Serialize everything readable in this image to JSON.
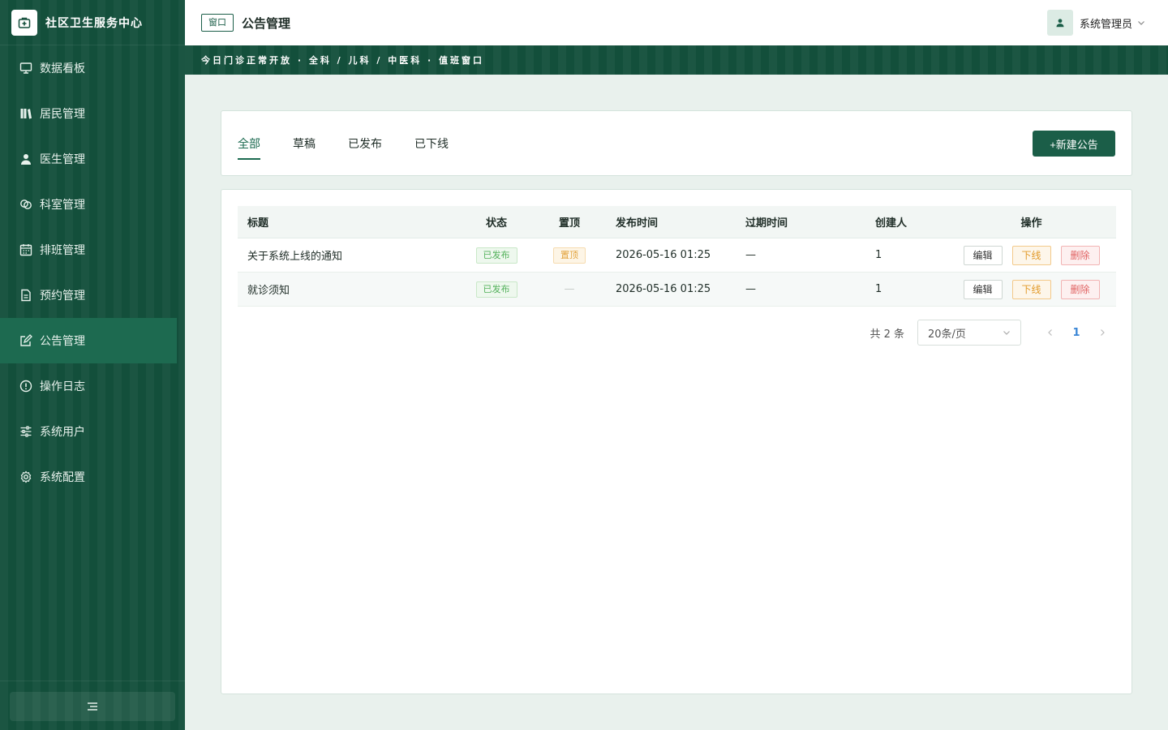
{
  "brand": {
    "title": "社区卫生服务中心"
  },
  "sidebar": {
    "items": [
      {
        "label": "数据看板",
        "icon": "monitor-icon"
      },
      {
        "label": "居民管理",
        "icon": "books-icon"
      },
      {
        "label": "医生管理",
        "icon": "person-icon"
      },
      {
        "label": "科室管理",
        "icon": "link-icon"
      },
      {
        "label": "排班管理",
        "icon": "calendar-icon"
      },
      {
        "label": "预约管理",
        "icon": "document-icon"
      },
      {
        "label": "公告管理",
        "icon": "edit-icon",
        "active": true
      },
      {
        "label": "操作日志",
        "icon": "info-icon"
      },
      {
        "label": "系统用户",
        "icon": "sliders-icon"
      },
      {
        "label": "系统配置",
        "icon": "gear-icon"
      }
    ]
  },
  "header": {
    "window_tag": "窗口",
    "title": "公告管理",
    "user_name": "系统管理员"
  },
  "ticker": {
    "text": "今日门诊正常开放 · 全科 / 儿科 / 中医科 · 值班窗口"
  },
  "tabs": {
    "items": [
      "全部",
      "草稿",
      "已发布",
      "已下线"
    ],
    "active": "全部",
    "new_label": "+新建公告"
  },
  "table": {
    "columns": [
      "标题",
      "状态",
      "置顶",
      "发布时间",
      "过期时间",
      "创建人",
      "操作"
    ],
    "rows": [
      {
        "title": "关于系统上线的通知",
        "status": "已发布",
        "pinned": "置顶",
        "published_at": "2026-05-16 01:25",
        "expires_at": "—",
        "creator": "1"
      },
      {
        "title": "就诊须知",
        "status": "已发布",
        "pinned": "—",
        "published_at": "2026-05-16 01:25",
        "expires_at": "—",
        "creator": "1"
      }
    ],
    "ops": {
      "edit": "编辑",
      "offline": "下线",
      "delete": "删除"
    }
  },
  "pagination": {
    "total_text": "共 2 条",
    "page_size": "20条/页",
    "current_page": "1"
  },
  "colors": {
    "sidebar_bg": "#134f3b",
    "accent": "#1b6a50",
    "status_green": "#52b15a",
    "pin_orange": "#e2a23c",
    "delete_red": "#e06262",
    "page_blue": "#3a86d6"
  }
}
